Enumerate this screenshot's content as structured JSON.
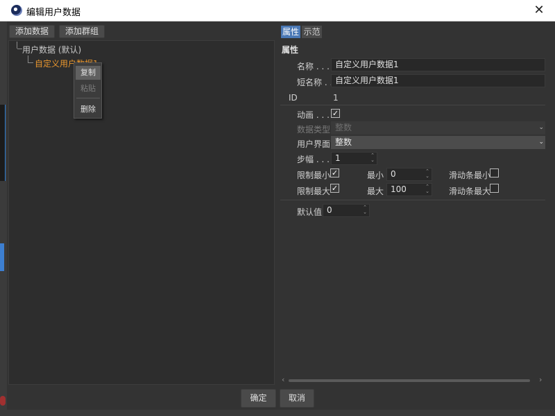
{
  "window": {
    "title": "编辑用户数据",
    "close_glyph": "✕"
  },
  "toolbar": {
    "add_data": "添加数据",
    "add_group": "添加群组"
  },
  "tree": {
    "root_label": "用户数据 (默认)",
    "child_label": "自定义用户数据1"
  },
  "context_menu": {
    "copy": "复制",
    "paste": "粘贴",
    "delete": "删除"
  },
  "tabs": {
    "properties": "属性",
    "example": "示范"
  },
  "properties": {
    "section_title": "属性",
    "name_label": "名称 . . . .",
    "name_value": "自定义用户数据1",
    "short_name_label": "短名称 . .",
    "short_name_value": "自定义用户数据1",
    "id_label": "ID",
    "id_value": "1",
    "animate_label": "动画 . . . .",
    "animate_checked": true,
    "data_type_label": "数据类型",
    "data_type_value": "整数",
    "interface_label": "用户界面",
    "interface_value": "整数",
    "step_label": "步幅 . . . .",
    "step_value": "1",
    "limit_min_label": "限制最小",
    "limit_min_checked": true,
    "min_label": "最小",
    "min_value": "0",
    "slider_min_label": "滑动条最小",
    "slider_min_checked": false,
    "limit_max_label": "限制最大",
    "limit_max_checked": true,
    "max_label": "最大",
    "max_value": "100",
    "slider_max_label": "滑动条最大",
    "slider_max_checked": false,
    "default_label": "默认值",
    "default_value": "0"
  },
  "footer": {
    "ok": "确定",
    "cancel": "取消"
  },
  "colors": {
    "accent": "#4a78b5",
    "tree_selected_text": "#e8962e",
    "background": "#333333"
  },
  "icons": {
    "check": "✓",
    "chevron_down": "⌄",
    "spin": "⌃⌄"
  }
}
